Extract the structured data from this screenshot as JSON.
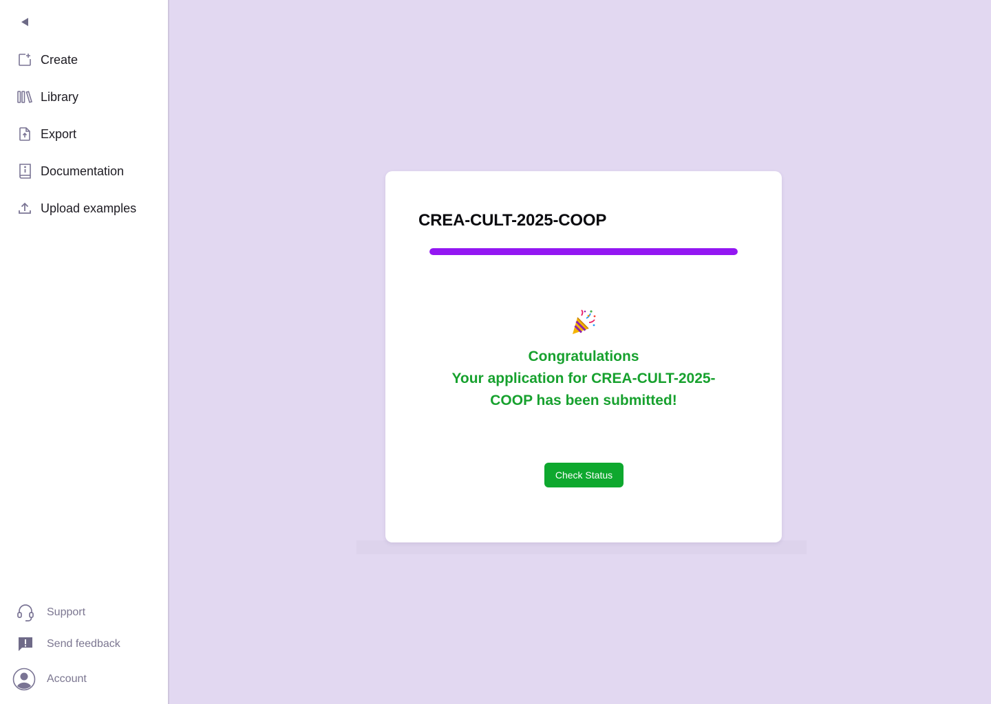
{
  "sidebar": {
    "items": [
      {
        "label": "Create",
        "icon": "create-icon"
      },
      {
        "label": "Library",
        "icon": "library-icon"
      },
      {
        "label": "Export",
        "icon": "export-icon"
      },
      {
        "label": "Documentation",
        "icon": "documentation-icon"
      },
      {
        "label": "Upload examples",
        "icon": "upload-icon"
      }
    ],
    "bottom": {
      "support": "Support",
      "feedback": "Send feedback",
      "account": "Account"
    }
  },
  "card": {
    "title": "CREA-CULT-2025-COOP",
    "progress_percent": 100,
    "line1": "Congratulations",
    "line2": "Your application for CREA-CULT-2025-COOP has been submitted!",
    "button_label": "Check Status"
  },
  "colors": {
    "background": "#e2d8f1",
    "progress": "#9317f2",
    "success_text": "#17a12e",
    "button": "#0ea82e"
  }
}
